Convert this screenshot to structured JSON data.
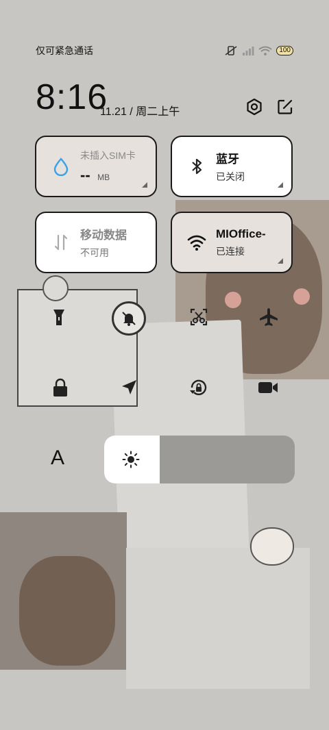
{
  "status_bar": {
    "carrier": "仅可紧急通话",
    "battery": "100"
  },
  "header": {
    "time": "8:16",
    "date": "11.21 / 周二上午"
  },
  "tiles": {
    "data_usage": {
      "title": "未插入SIM卡",
      "value": "--",
      "unit": "MB"
    },
    "bluetooth": {
      "title": "蓝牙",
      "status": "已关闭"
    },
    "mobile_data": {
      "title": "移动数据",
      "status": "不可用"
    },
    "wifi": {
      "title": "MIOffice-",
      "status": "已连接"
    }
  },
  "toggles": [
    "flashlight-icon",
    "mute-icon",
    "screenshot-icon",
    "airplane-icon",
    "lock-screen-icon",
    "location-icon",
    "rotation-lock-icon",
    "screen-record-icon"
  ],
  "brightness": {
    "level": 0.29
  },
  "font_label": "A",
  "colors": {
    "accent_blue": "#3aa0e8",
    "tile_light": "#ffffff",
    "tile_active": "#e6e1dc"
  }
}
